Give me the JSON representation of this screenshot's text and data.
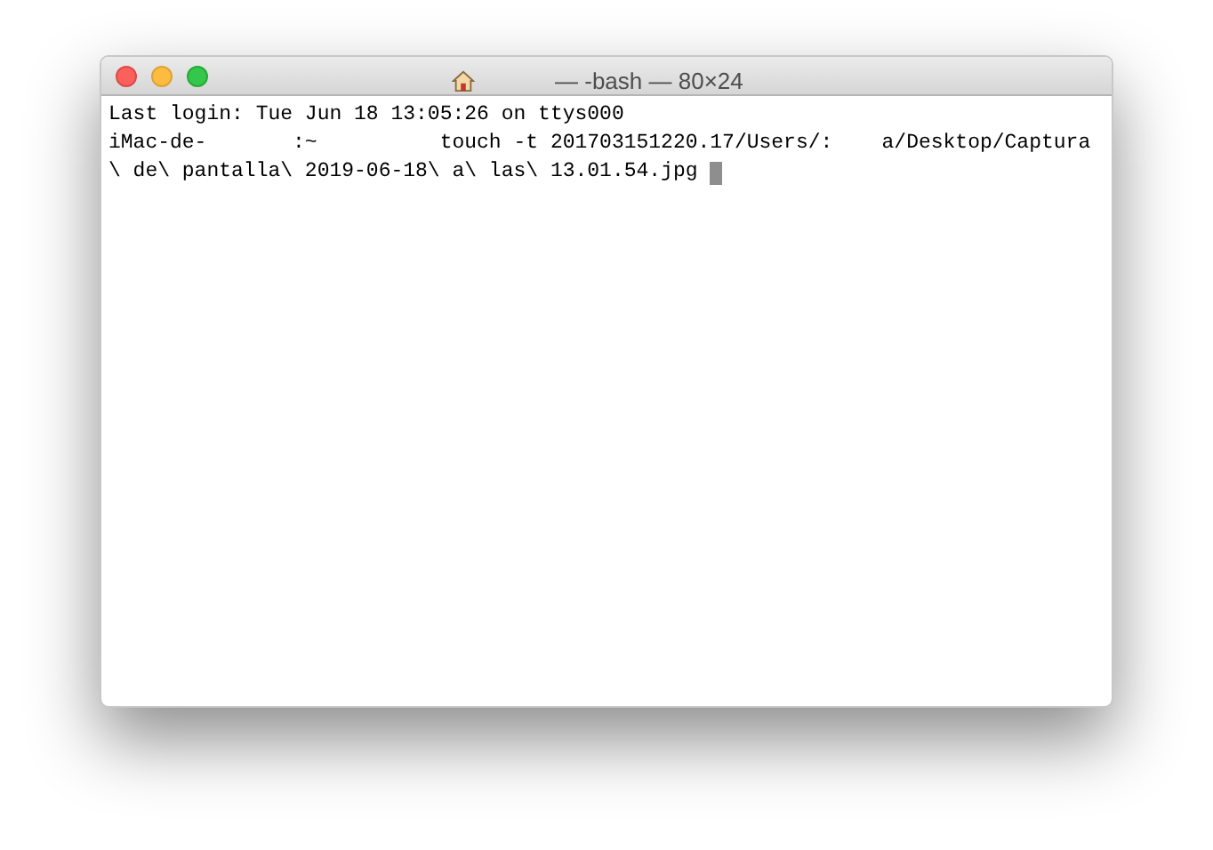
{
  "window": {
    "title": "— -bash — 80×24"
  },
  "terminal": {
    "lines": [
      "Last login: Tue Jun 18 13:05:26 on ttys000",
      "iMac-de-       :~          touch -t 201703151220.17/Users/:    a/Desktop/Captura",
      "\\ de\\ pantalla\\ 2019-06-18\\ a\\ las\\ 13.01.54.jpg "
    ],
    "cursor": true
  }
}
